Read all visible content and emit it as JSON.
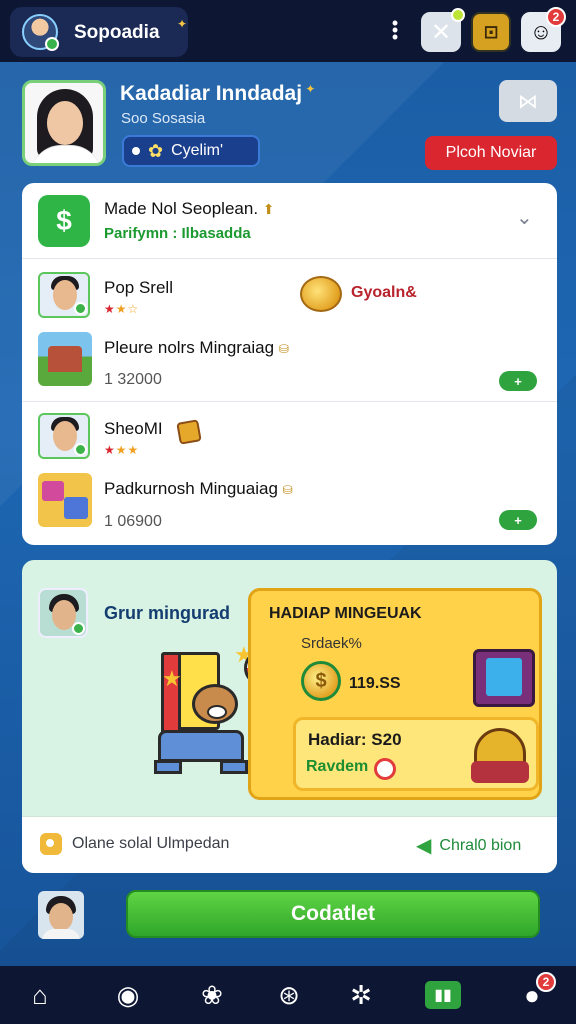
{
  "header": {
    "app_title": "Sopoadia",
    "notification_count": "2"
  },
  "profile": {
    "name": "Kadadiar Inndadaj",
    "subtitle": "Soo Sosasia",
    "status_label": "Cyelim'",
    "primary_button": "Plcoh Noviar"
  },
  "feed": {
    "title": "Made Nol Seoplean.",
    "subtitle": "Parifymn : Ilbasadda",
    "items": [
      {
        "name": "Pop Srell",
        "coin_label": "Gyoaln&",
        "description": "Pleure nolrs Mingraiag",
        "value": "1 32000",
        "action": "+"
      },
      {
        "name": "SheoMI",
        "description": "Padkurnosh Minguaiag",
        "value": "1 06900",
        "action": "+"
      }
    ]
  },
  "rewards": {
    "heading": "Grur mingurad",
    "offer": {
      "title": "HADIAP MINGEUAK",
      "subtitle": "Srdaek%",
      "price": "119.SS",
      "inner_title": "Hadiar: S20",
      "inner_sub": "Ravdem"
    },
    "footer_left": "Olane solal Ulmpedan",
    "footer_right": "Chral0 bion"
  },
  "cta_button": "Codatlet",
  "tabbar": {
    "profile_badge": "2"
  },
  "icons": {
    "home": "home-icon",
    "explore": "compass-icon",
    "paw": "paw-icon",
    "games": "ball-icon",
    "settings": "gear-icon",
    "store": "store-icon",
    "profile": "user-icon"
  },
  "colors": {
    "accent_green": "#2fa62a",
    "primary_red": "#d9262f",
    "background_blue": "#1e67b3",
    "topbar": "#0d1633"
  }
}
